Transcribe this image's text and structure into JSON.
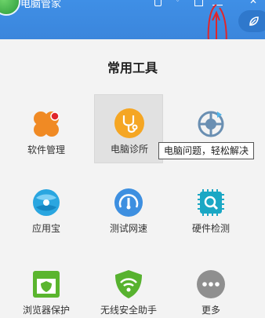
{
  "window": {
    "title": "电脑管家"
  },
  "section": {
    "title": "常用工具"
  },
  "tools": [
    {
      "label": "软件管理",
      "icon": "software-manage-icon",
      "color": "#f08a24"
    },
    {
      "label": "电脑诊所",
      "icon": "stethoscope-icon",
      "color": "#f5a623"
    },
    {
      "label": "",
      "icon": "computer-problem-icon",
      "color": "#6a8fb2"
    },
    {
      "label": "应用宝",
      "icon": "app-store-icon",
      "color": "#2aa6e0"
    },
    {
      "label": "测试网速",
      "icon": "speed-test-icon",
      "color": "#3d8fe0"
    },
    {
      "label": "硬件检测",
      "icon": "hardware-check-icon",
      "color": "#1aa7c4"
    },
    {
      "label": "浏览器保护",
      "icon": "browser-protect-icon",
      "color": "#5ab52e"
    },
    {
      "label": "无线安全助手",
      "icon": "wifi-security-icon",
      "color": "#57b22f"
    },
    {
      "label": "更多",
      "icon": "more-icon",
      "color": "#8f8f8f"
    }
  ],
  "tooltip": {
    "text": "电脑问题，轻松解决"
  },
  "colors": {
    "titlebar": "#3b86dc",
    "accent_red": "#e0262b"
  }
}
